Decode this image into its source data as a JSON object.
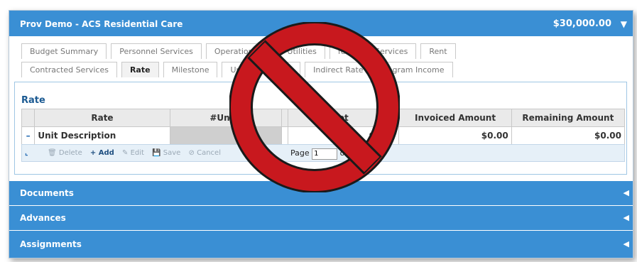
{
  "header": {
    "title": "Prov Demo - ACS Residential Care",
    "amount": "$30,000.00",
    "caret": "▼"
  },
  "tabs_row1": [
    "Budget Summary",
    "Personnel Services",
    "Operations &",
    "Utilities",
    "fessional Services",
    "Rent"
  ],
  "tabs_row2": [
    "Contracted Services",
    "Rate",
    "Milestone",
    "Unall",
    "ls",
    "Indirect Rate",
    "rogram Income"
  ],
  "active_tab": "Rate",
  "panel": {
    "title": "Rate"
  },
  "grid": {
    "columns": [
      "Rate",
      "#Units",
      "",
      "et",
      "Invoiced Amount",
      "Remaining Amount"
    ],
    "row": {
      "toggle": "–",
      "description": "Unit Description",
      "units": "",
      "blank": "",
      "budget": "$0.00",
      "invoiced": "$0.00",
      "remaining": "$0.00"
    }
  },
  "toolbar": {
    "corner": "⌞",
    "delete": "🗑 Delete",
    "add": "+ Add",
    "edit": "✎ Edit",
    "save": "💾 Save",
    "cancel": "⊘ Cancel",
    "page_label": "Page",
    "page_value": "1",
    "of_label": "of 0"
  },
  "sections": [
    {
      "label": "Documents",
      "indicator": "◀"
    },
    {
      "label": "Advances",
      "indicator": "◀"
    },
    {
      "label": "Assignments",
      "indicator": "◀"
    }
  ],
  "overlay": {
    "icon": "prohibited-icon",
    "color": "#c8181e"
  }
}
